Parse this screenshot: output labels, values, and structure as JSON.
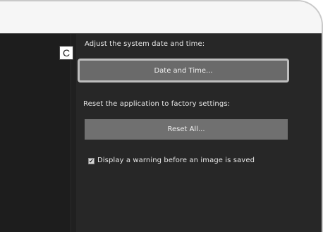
{
  "callout": {
    "letter": "C"
  },
  "settings": {
    "date_section_label": "Adjust the system date and time:",
    "date_button_label": "Date and Time...",
    "reset_section_label": "Reset the application to factory settings:",
    "reset_button_label": "Reset All...",
    "warning_checkbox": {
      "checked": true,
      "label": "Display a warning before an image is saved"
    }
  }
}
